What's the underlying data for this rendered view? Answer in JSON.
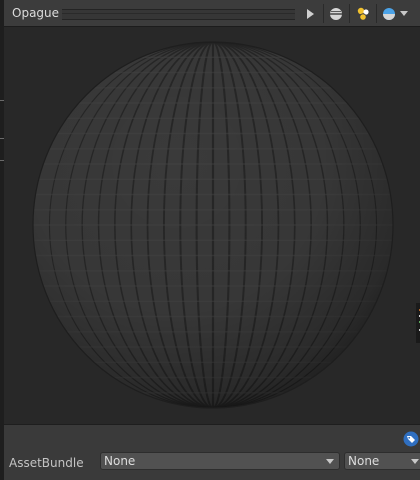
{
  "header": {
    "title": "Opague"
  },
  "footer": {
    "asset_bundle_label": "AssetBundle",
    "bundle_name_value": "None",
    "bundle_variant_value": "None"
  },
  "colors": {
    "accent": "#3d8eea",
    "background": "#282828",
    "sphere_base": "#3a3a3a"
  },
  "icons": [
    "play-icon",
    "sphere-mesh-icon",
    "light-icon",
    "skybox-icon",
    "chevron-down-icon",
    "tag-icon"
  ]
}
